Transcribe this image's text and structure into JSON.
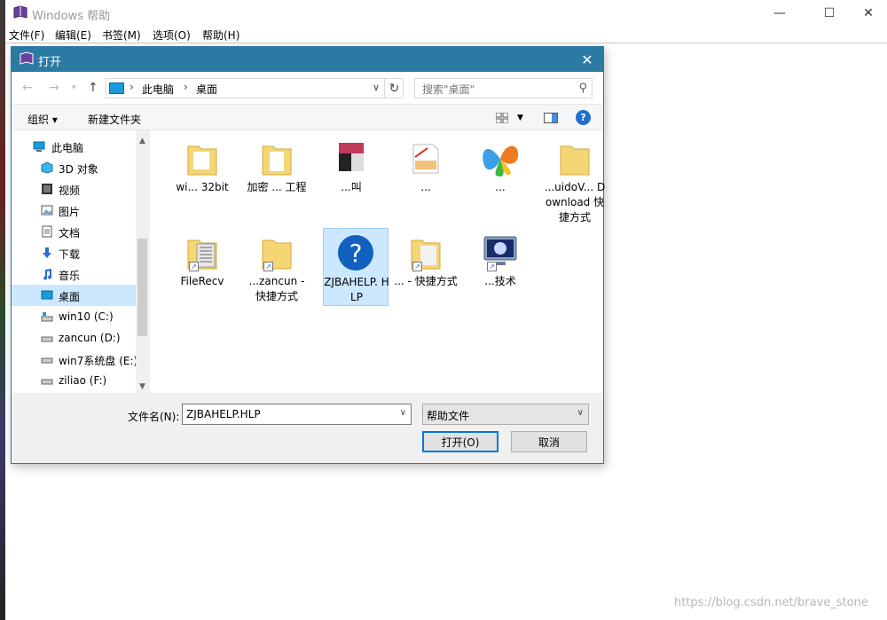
{
  "main_window": {
    "title": "Windows 帮助",
    "controls": {
      "minimize": "—",
      "maximize": "☐",
      "close": "✕"
    },
    "menu": [
      "文件(F)",
      "编辑(E)",
      "书签(M)",
      "选项(O)",
      "帮助(H)"
    ]
  },
  "dialog": {
    "title": "打开",
    "close": "✕",
    "address": {
      "crumbs": [
        "此电脑",
        "桌面"
      ]
    },
    "search_placeholder": "搜索\"桌面\"",
    "toolbar": {
      "organize": "组织 ▾",
      "new_folder": "新建文件夹",
      "help": "?"
    },
    "tree": [
      {
        "label": "此电脑",
        "icon": "computer-icon"
      },
      {
        "label": "3D 对象",
        "icon": "cube-icon"
      },
      {
        "label": "视频",
        "icon": "video-icon"
      },
      {
        "label": "图片",
        "icon": "picture-icon"
      },
      {
        "label": "文档",
        "icon": "document-icon"
      },
      {
        "label": "下载",
        "icon": "download-icon"
      },
      {
        "label": "音乐",
        "icon": "music-icon"
      },
      {
        "label": "桌面",
        "icon": "desktop-icon",
        "selected": true
      },
      {
        "label": "win10 (C:)",
        "icon": "drive-icon"
      },
      {
        "label": "zancun (D:)",
        "icon": "drive-icon"
      },
      {
        "label": "win7系统盘 (E:)",
        "icon": "drive-icon"
      },
      {
        "label": "ziliao (F:)",
        "icon": "drive-icon"
      }
    ],
    "files": [
      {
        "label": "wi... 32bit",
        "icon": "folder-icon"
      },
      {
        "label": "加密 ... 工程",
        "icon": "folder-icon"
      },
      {
        "label": "...叫",
        "icon": "image-file-icon"
      },
      {
        "label": "...",
        "icon": "document-file-icon"
      },
      {
        "label": "...",
        "icon": "msn-butterfly-icon"
      },
      {
        "label": "...uidoV... Download 快捷方式",
        "icon": "folder-icon"
      },
      {
        "label": "FileRecv",
        "icon": "folder-icon",
        "shortcut": true
      },
      {
        "label": "...zancun - 快捷方式",
        "icon": "folder-icon",
        "shortcut": true
      },
      {
        "label": "ZJBAHELP. HLP",
        "icon": "help-file-icon",
        "selected": true
      },
      {
        "label": "... - 快捷方式",
        "icon": "folder-icon",
        "shortcut": true
      },
      {
        "label": "...技术",
        "icon": "monitor-icon",
        "shortcut": true
      }
    ],
    "filename_label": "文件名(N):",
    "filename_value": "ZJBAHELP.HLP",
    "filetype_value": "帮助文件",
    "open_button": "打开(O)",
    "cancel_button": "取消"
  },
  "watermark": "https://blog.csdn.net/brave_stone"
}
